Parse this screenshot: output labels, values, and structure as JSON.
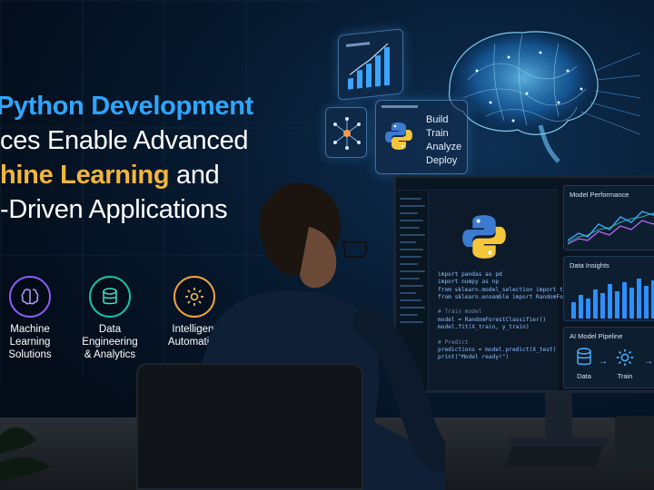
{
  "headline": {
    "line1": "Python Development",
    "line2": "ces Enable Advanced",
    "line3_accent": "hine Learning",
    "line3_rest": " and",
    "line4": "-Driven Applications"
  },
  "features": [
    {
      "label": "Machine\nLearning\nSolutions",
      "icon": "brain-icon",
      "color": "#8b5cf6"
    },
    {
      "label": "Data\nEngineering\n& Analytics",
      "icon": "database-icon",
      "color": "#19c2a8"
    },
    {
      "label": "Intelligent\nAutomation",
      "icon": "gear-icon",
      "color": "#f2a33c"
    }
  ],
  "workflow": [
    "Build",
    "Train",
    "Analyze",
    "Deploy"
  ],
  "monitor": {
    "code": [
      "import pandas as pd",
      "import numpy as np",
      "from sklearn.model_selection import train_test_split",
      "from sklearn.ensemble import RandomForestClassifier",
      "",
      "# Train model",
      "model = RandomForestClassifier()",
      "model.fit(X_train, y_train)",
      "",
      "# Predict",
      "predictions = model.predict(X_test)",
      "print(\"Model ready!\")"
    ],
    "model_performance_title": "Model Performance",
    "data_insights_title": "Data Insights",
    "pipeline_title": "AI Model Pipeline",
    "pipeline_steps": [
      "Data",
      "Train"
    ]
  },
  "colors": {
    "accent_blue": "#2ea6ff",
    "accent_gold": "#f2b53c",
    "python_blue": "#3b7bd0",
    "python_yellow": "#f5c63a"
  }
}
